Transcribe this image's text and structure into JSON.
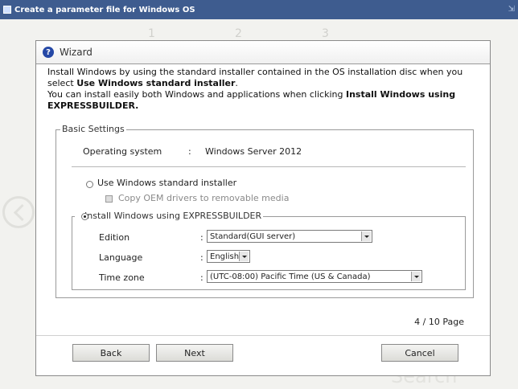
{
  "window": {
    "title": "Create a parameter file for Windows OS",
    "corner_text": "⇲",
    "background_ghost": [
      "1",
      "2",
      "3"
    ],
    "bottom_ghost_text": "Search"
  },
  "wizard": {
    "title": "Wizard",
    "intro": {
      "line1": "Install Windows by using the standard installer contained in the OS installation disc when you",
      "line2_prefix": "select ",
      "line2_bold": "Use Windows standard installer",
      "line2_suffix": ".",
      "line3_prefix": "You can install easily both Windows and applications when clicking ",
      "line3_bold": "Install Windows using",
      "line4_bold": "EXPRESSBUILDER."
    },
    "basic_settings": {
      "legend": "Basic Settings",
      "os_label": "Operating system",
      "colon": ":",
      "os_value": "Windows Server 2012",
      "option_standard": "Use Windows standard installer",
      "copy_oem_label": "Copy OEM drivers to removable media",
      "option_expressbuilder": "Install Windows using EXPRESSBUILDER"
    },
    "express": {
      "edition_label": "Edition",
      "edition_value": "Standard(GUI server)",
      "language_label": "Language",
      "language_value": "English",
      "timezone_label": "Time zone",
      "timezone_value": "(UTC-08:00) Pacific Time (US & Canada)"
    },
    "page_indicator": "4 / 10 Page",
    "buttons": {
      "back": "Back",
      "next": "Next",
      "cancel": "Cancel"
    }
  }
}
